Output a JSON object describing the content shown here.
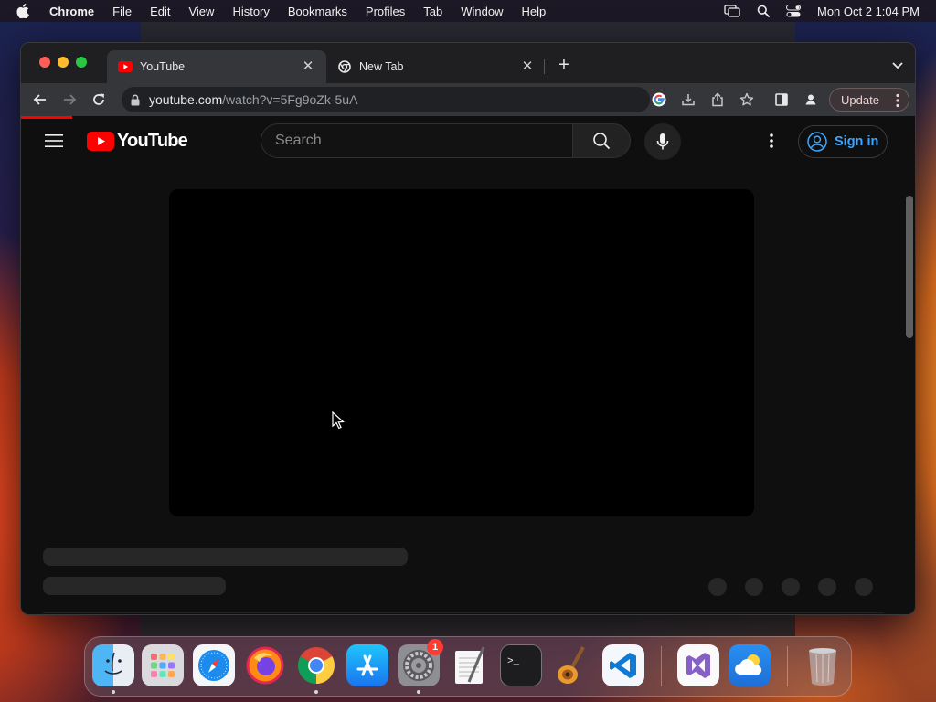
{
  "menubar": {
    "app_name": "Chrome",
    "items": [
      "File",
      "Edit",
      "View",
      "History",
      "Bookmarks",
      "Profiles",
      "Tab",
      "Window",
      "Help"
    ],
    "clock": "Mon Oct 2  1:04 PM",
    "status_icons": [
      "screen-mirroring-icon",
      "spotlight-search-icon",
      "control-center-icon"
    ]
  },
  "browser": {
    "tabs": [
      {
        "title": "YouTube",
        "icon": "youtube-favicon",
        "active": true
      },
      {
        "title": "New Tab",
        "icon": "chrome-favicon",
        "active": false
      }
    ],
    "url_host": "youtube.com",
    "url_path": "/watch?v=5Fg9oZk-5uA",
    "update_label": "Update"
  },
  "youtube": {
    "logo_text": "YouTube",
    "search_placeholder": "Search",
    "signin_label": "Sign in",
    "brand_color": "#ff0000",
    "link_color": "#3ea6ff"
  },
  "dock": {
    "apps": [
      {
        "name": "Finder",
        "icon": "finder-icon",
        "running": true
      },
      {
        "name": "Launchpad",
        "icon": "launchpad-icon",
        "running": false
      },
      {
        "name": "Safari",
        "icon": "safari-icon",
        "running": false
      },
      {
        "name": "Firefox",
        "icon": "firefox-icon",
        "running": false
      },
      {
        "name": "Google Chrome",
        "icon": "chrome-icon",
        "running": true
      },
      {
        "name": "App Store",
        "icon": "app-store-icon",
        "running": false
      },
      {
        "name": "System Settings",
        "icon": "system-settings-icon",
        "running": true,
        "badge": "1"
      },
      {
        "name": "TextEdit",
        "icon": "textedit-icon",
        "running": false
      },
      {
        "name": "Terminal",
        "icon": "terminal-icon",
        "running": false
      },
      {
        "name": "GarageBand",
        "icon": "garageband-icon",
        "running": false
      },
      {
        "name": "Visual Studio Code",
        "icon": "vscode-icon",
        "running": false
      },
      {
        "name": "Visual Studio",
        "icon": "visual-studio-icon",
        "running": false
      },
      {
        "name": "Weather",
        "icon": "weather-icon",
        "running": false
      },
      {
        "name": "Trash",
        "icon": "trash-icon",
        "running": false
      }
    ]
  }
}
